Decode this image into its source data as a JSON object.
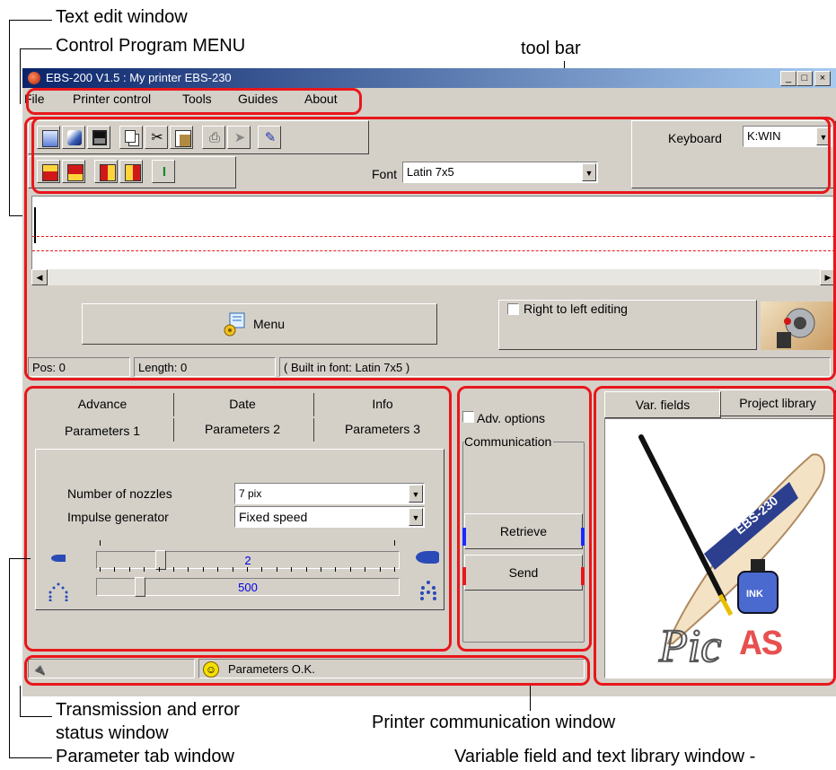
{
  "callouts": {
    "text_edit_window": "Text edit window",
    "control_program_menu": "Control Program MENU",
    "tool_bar": "tool bar",
    "transmission_status": "Transmission and error\nstatus window",
    "parameter_tab_window": "Parameter tab window",
    "printer_communication_window": "Printer communication window",
    "variable_field_window": "Variable field and text library window -"
  },
  "window": {
    "title": "EBS-200 V1.5  :  My printer EBS-230",
    "controls": [
      "_",
      "□",
      "×"
    ]
  },
  "menu": [
    "File",
    "Printer control",
    "Tools",
    "Guides",
    "About"
  ],
  "toolbar": {
    "keyboard_label": "Keyboard",
    "keyboard_value": "K:WIN",
    "font_label": "Font",
    "font_value": "Latin 7x5",
    "icons_row1": [
      "new-file-icon",
      "open-file-icon",
      "save-icon",
      "copy-icon",
      "cut-icon",
      "paste-icon",
      "print-icon",
      "send-arrow-icon",
      "pen-icon"
    ],
    "icons_row2": [
      "insert-field-icon",
      "insert-field-2-icon",
      "counter-icon",
      "counter-2-icon",
      "cursor-icon"
    ]
  },
  "editor": {
    "menu_button": "Menu",
    "rtl_label": "Right to left editing",
    "status_pos": "Pos: 0",
    "status_length": "Length: 0",
    "status_font": "( Built in font: Latin 7x5 )"
  },
  "params": {
    "tabs_row1": [
      "Advance",
      "Date",
      "Info"
    ],
    "tabs_row2": [
      "Parameters 1",
      "Parameters 2",
      "Parameters 3"
    ],
    "nozzles_label": "Number of nozzles",
    "nozzles_value": "7 pix",
    "impulse_label": "Impulse generator",
    "impulse_value": "Fixed speed",
    "slider1_value": "2",
    "slider2_value": "500",
    "slider1_level": 0.2,
    "slider2_level": 0.13
  },
  "comm": {
    "adv_options": "Adv. options",
    "group_label": "Communication",
    "retrieve": "Retrieve",
    "send": "Send"
  },
  "library": {
    "tab_var": "Var. fields",
    "tab_project": "Project library",
    "logo_band_text": "EBS-230",
    "logo_text_pic": "Pic",
    "logo_text_as": "AS",
    "ink_label": "INK"
  },
  "status": {
    "message": "Parameters O.K."
  },
  "colors": {
    "highlight": "#e8171b",
    "titlebar_start": "#0a246a",
    "titlebar_end": "#a6caf0",
    "face": "#d4d0c8"
  }
}
